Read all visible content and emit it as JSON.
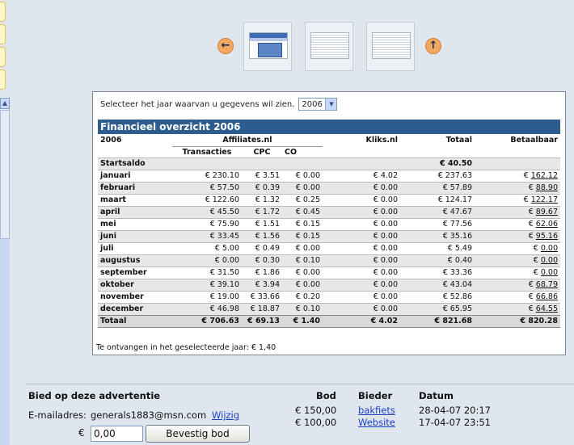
{
  "gallery": {
    "prev_icon": "arrow-left-icon",
    "next_icon": "arrow-up-icon",
    "thumbnails": [
      "screenshot-thumb-1",
      "screenshot-thumb-2",
      "screenshot-thumb-3"
    ]
  },
  "year_selector": {
    "label": "Selecteer het jaar waarvan u gegevens wil zien.",
    "selected": "2006"
  },
  "finance": {
    "title": "Financieel overzicht 2006",
    "headers": {
      "year": "2006",
      "affiliates": "Affiliates.nl",
      "transacties": "Transacties",
      "cpc": "CPC",
      "co": "CO",
      "kliks": "Kliks.nl",
      "totaal": "Totaal",
      "betaalbaar": "Betaalbaar"
    },
    "start": {
      "label": "Startsaldo",
      "totaal": "€ 40.50"
    },
    "rows": [
      {
        "month": "januari",
        "transacties": "€ 230.10",
        "cpc": "€ 3.51",
        "co": "€ 0.00",
        "kliks": "€ 4.02",
        "totaal": "€ 237.63",
        "betaalbaar": "€ 162.12"
      },
      {
        "month": "februari",
        "transacties": "€ 57.50",
        "cpc": "€ 0.39",
        "co": "€ 0.00",
        "kliks": "€ 0.00",
        "totaal": "€ 57.89",
        "betaalbaar": "€ 88.90"
      },
      {
        "month": "maart",
        "transacties": "€ 122.60",
        "cpc": "€ 1.32",
        "co": "€ 0.25",
        "kliks": "€ 0.00",
        "totaal": "€ 124.17",
        "betaalbaar": "€ 122.17"
      },
      {
        "month": "april",
        "transacties": "€ 45.50",
        "cpc": "€ 1.72",
        "co": "€ 0.45",
        "kliks": "€ 0.00",
        "totaal": "€ 47.67",
        "betaalbaar": "€ 89.67"
      },
      {
        "month": "mei",
        "transacties": "€ 75.90",
        "cpc": "€ 1.51",
        "co": "€ 0.15",
        "kliks": "€ 0.00",
        "totaal": "€ 77.56",
        "betaalbaar": "€ 62.06"
      },
      {
        "month": "juni",
        "transacties": "€ 33.45",
        "cpc": "€ 1.56",
        "co": "€ 0.15",
        "kliks": "€ 0.00",
        "totaal": "€ 35.16",
        "betaalbaar": "€ 95.16"
      },
      {
        "month": "juli",
        "transacties": "€ 5.00",
        "cpc": "€ 0.49",
        "co": "€ 0.00",
        "kliks": "€ 0.00",
        "totaal": "€ 5.49",
        "betaalbaar": "€ 0.00"
      },
      {
        "month": "augustus",
        "transacties": "€ 0.00",
        "cpc": "€ 0.30",
        "co": "€ 0.10",
        "kliks": "€ 0.00",
        "totaal": "€ 0.40",
        "betaalbaar": "€ 0.00"
      },
      {
        "month": "september",
        "transacties": "€ 31.50",
        "cpc": "€ 1.86",
        "co": "€ 0.00",
        "kliks": "€ 0.00",
        "totaal": "€ 33.36",
        "betaalbaar": "€ 0.00"
      },
      {
        "month": "oktober",
        "transacties": "€ 39.10",
        "cpc": "€ 3.94",
        "co": "€ 0.00",
        "kliks": "€ 0.00",
        "totaal": "€ 43.04",
        "betaalbaar": "€ 68.79"
      },
      {
        "month": "november",
        "transacties": "€ 19.00",
        "cpc": "€ 33.66",
        "co": "€ 0.20",
        "kliks": "€ 0.00",
        "totaal": "€ 52.86",
        "betaalbaar": "€ 66.86"
      },
      {
        "month": "december",
        "transacties": "€ 46.98",
        "cpc": "€ 18.87",
        "co": "€ 0.10",
        "kliks": "€ 0.00",
        "totaal": "€ 65.95",
        "betaalbaar": "€ 64.55"
      }
    ],
    "total": {
      "label": "Totaal",
      "transacties": "€ 706.63",
      "cpc": "€ 69.13",
      "co": "€ 1.40",
      "kliks": "€ 4.02",
      "totaal": "€ 821.68",
      "betaalbaar": "€ 820.28"
    },
    "receive_text": "Te ontvangen in het geselecteerde jaar: € 1,40"
  },
  "bid": {
    "title": "Bied op deze advertentie",
    "email_label": "E-mailadres:",
    "email_value": "generals1883@msn.com",
    "change_link": "Wijzig",
    "currency": "€",
    "input_value": "0,00",
    "button_label": "Bevestig bod",
    "columns": {
      "bod": "Bod",
      "bieder": "Bieder",
      "datum": "Datum"
    },
    "rows": [
      {
        "bod": "€ 150,00",
        "bieder": "bakfiets",
        "datum": "28-04-07 20:17"
      },
      {
        "bod": "€ 100,00",
        "bieder": "Website",
        "datum": "17-04-07 23:51"
      }
    ]
  }
}
